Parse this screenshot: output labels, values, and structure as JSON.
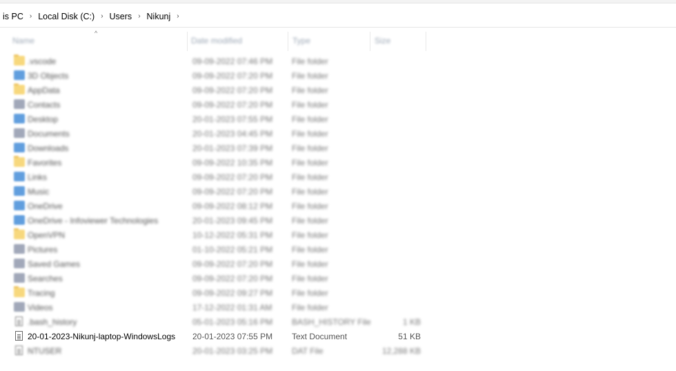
{
  "breadcrumb": {
    "items": [
      "is PC",
      "Local Disk (C:)",
      "Users",
      "Nikunj"
    ],
    "separator": "›"
  },
  "columns": {
    "name": "Name",
    "date_modified": "Date modified",
    "type": "Type",
    "size": "Size"
  },
  "rows": [
    {
      "name": ".vscode",
      "date": "09-09-2022 07:46 PM",
      "type": "File folder",
      "size": "",
      "icon": "folder-icon"
    },
    {
      "name": "3D Objects",
      "date": "09-09-2022 07:20 PM",
      "type": "File folder",
      "size": "",
      "icon": "3d-objects-icon"
    },
    {
      "name": "AppData",
      "date": "09-09-2022 07:20 PM",
      "type": "File folder",
      "size": "",
      "icon": "folder-icon"
    },
    {
      "name": "Contacts",
      "date": "09-09-2022 07:20 PM",
      "type": "File folder",
      "size": "",
      "icon": "contacts-icon"
    },
    {
      "name": "Desktop",
      "date": "20-01-2023 07:55 PM",
      "type": "File folder",
      "size": "",
      "icon": "desktop-icon"
    },
    {
      "name": "Documents",
      "date": "20-01-2023 04:45 PM",
      "type": "File folder",
      "size": "",
      "icon": "documents-icon"
    },
    {
      "name": "Downloads",
      "date": "20-01-2023 07:39 PM",
      "type": "File folder",
      "size": "",
      "icon": "downloads-icon"
    },
    {
      "name": "Favorites",
      "date": "09-09-2022 10:35 PM",
      "type": "File folder",
      "size": "",
      "icon": "favorites-icon"
    },
    {
      "name": "Links",
      "date": "09-09-2022 07:20 PM",
      "type": "File folder",
      "size": "",
      "icon": "links-icon"
    },
    {
      "name": "Music",
      "date": "09-09-2022 07:20 PM",
      "type": "File folder",
      "size": "",
      "icon": "music-icon"
    },
    {
      "name": "OneDrive",
      "date": "09-09-2022 08:12 PM",
      "type": "File folder",
      "size": "",
      "icon": "onedrive-icon"
    },
    {
      "name": "OneDrive - Infoviewer Technologies",
      "date": "20-01-2023 09:45 PM",
      "type": "File folder",
      "size": "",
      "icon": "onedrive-icon"
    },
    {
      "name": "OpenVPN",
      "date": "10-12-2022 05:31 PM",
      "type": "File folder",
      "size": "",
      "icon": "folder-icon"
    },
    {
      "name": "Pictures",
      "date": "01-10-2022 05:21 PM",
      "type": "File folder",
      "size": "",
      "icon": "pictures-icon"
    },
    {
      "name": "Saved Games",
      "date": "09-09-2022 07:20 PM",
      "type": "File folder",
      "size": "",
      "icon": "saved-games-icon"
    },
    {
      "name": "Searches",
      "date": "09-09-2022 07:20 PM",
      "type": "File folder",
      "size": "",
      "icon": "searches-icon"
    },
    {
      "name": "Tracing",
      "date": "09-09-2022 09:27 PM",
      "type": "File folder",
      "size": "",
      "icon": "folder-icon"
    },
    {
      "name": "Videos",
      "date": "17-12-2022 01:31 AM",
      "type": "File folder",
      "size": "",
      "icon": "videos-icon"
    },
    {
      "name": ".bash_history",
      "date": "05-01-2023 05:16 PM",
      "type": "BASH_HISTORY File",
      "size": "1 KB",
      "icon": "file-icon"
    },
    {
      "name": "20-01-2023-Nikunj-laptop-WindowsLogs",
      "date": "20-01-2023 07:55 PM",
      "type": "Text Document",
      "size": "51 KB",
      "icon": "text-document-icon"
    },
    {
      "name": "NTUSER",
      "date": "20-01-2023 03:25 PM",
      "type": "DAT File",
      "size": "12,288 KB",
      "icon": "file-icon"
    }
  ],
  "clear_row_index": 19,
  "colors": {
    "folder": "#f6cf5d",
    "blue": "#3a86d6",
    "grey": "#8a93a8",
    "header_text": "#4c607a"
  }
}
